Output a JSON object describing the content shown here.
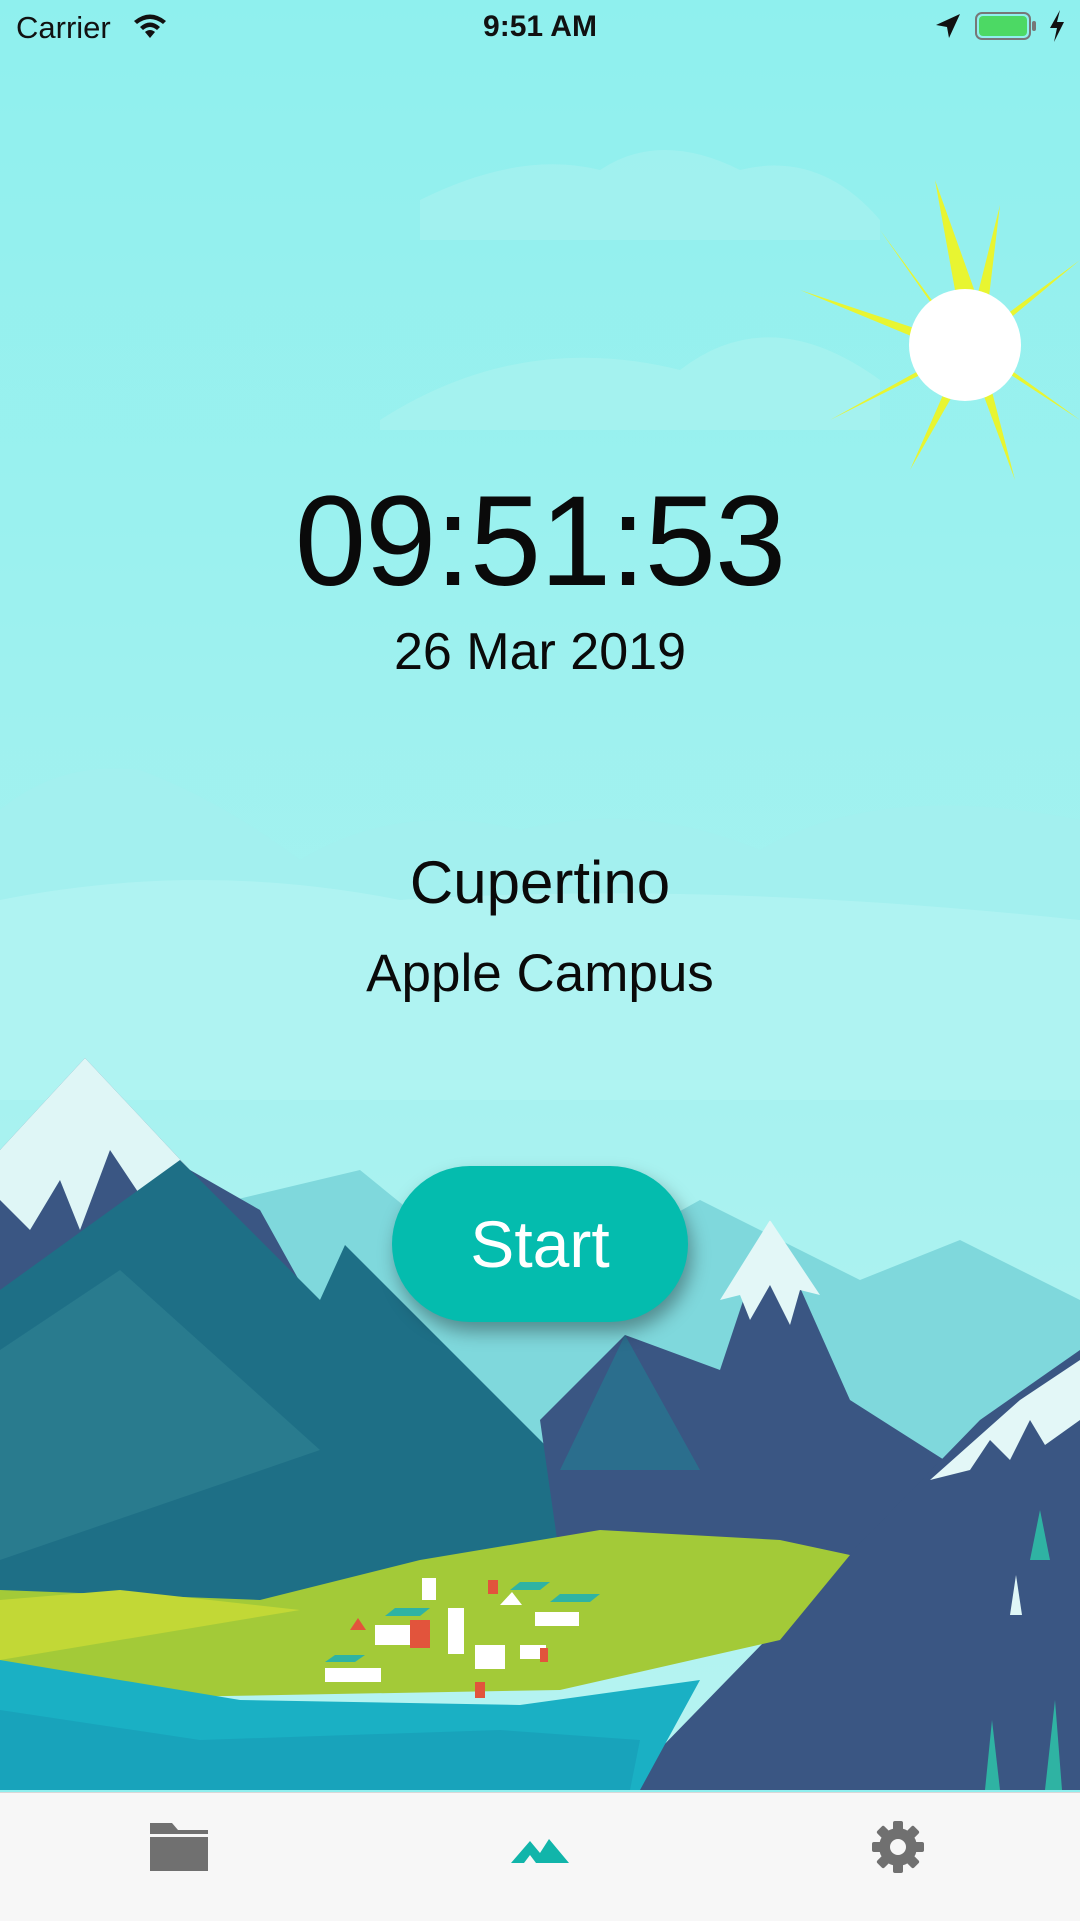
{
  "status_bar": {
    "carrier": "Carrier",
    "time": "9:51 AM",
    "icons": [
      "wifi-icon",
      "location-arrow-icon",
      "battery-icon",
      "charging-bolt-icon"
    ],
    "battery_color": "#4cd964"
  },
  "main": {
    "clock": "09:51:53",
    "date": "26 Mar 2019",
    "city": "Cupertino",
    "place": "Apple Campus",
    "start_label": "Start"
  },
  "tab_bar": {
    "tabs": [
      {
        "icon": "folder-icon",
        "active": false
      },
      {
        "icon": "mountain-icon",
        "active": true
      },
      {
        "icon": "gear-icon",
        "active": false
      }
    ],
    "active_color": "#11b5aa",
    "inactive_color": "#707070"
  },
  "colors": {
    "sky": "#8fefee",
    "accent": "#04bcae",
    "sun": "#e8f531"
  }
}
